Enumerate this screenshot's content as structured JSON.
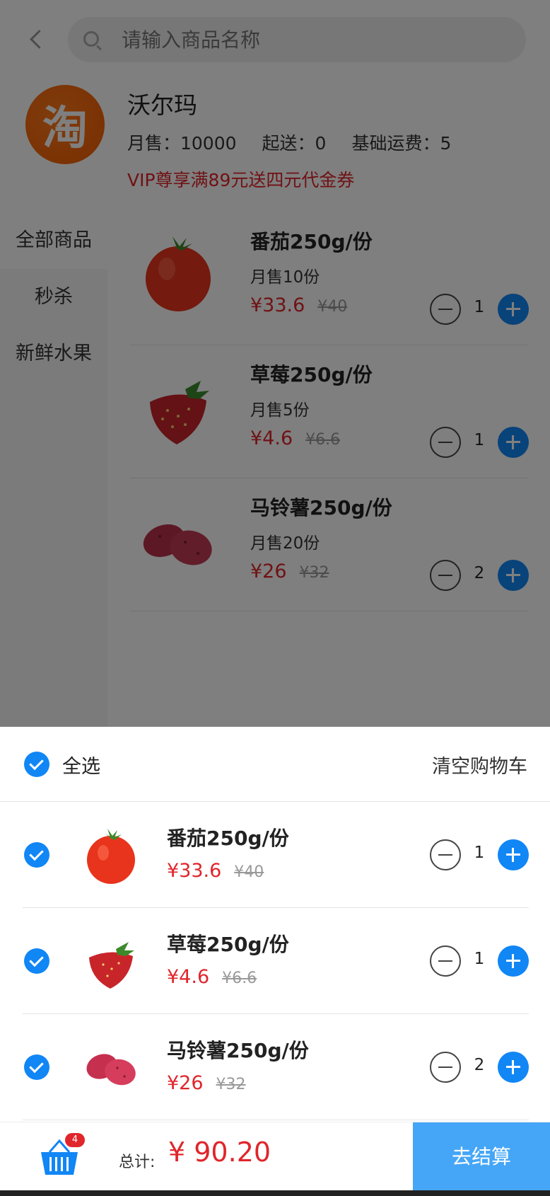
{
  "search": {
    "placeholder": "请输入商品名称"
  },
  "shop": {
    "logo_text": "淘",
    "name": "沃尔玛",
    "monthly_sales": "月售：10000",
    "min_delivery": "起送：0",
    "base_shipping": "基础运费：5",
    "promo": "VIP尊享满89元送四元代金券"
  },
  "categories": [
    "全部商品",
    "秒杀",
    "新鲜水果"
  ],
  "products": [
    {
      "name": "番茄250g/份",
      "sales": "月售10份",
      "price": "¥33.6",
      "old_price": "¥40",
      "qty": "1",
      "image": "tomato"
    },
    {
      "name": "草莓250g/份",
      "sales": "月售5份",
      "price": "¥4.6",
      "old_price": "¥6.6",
      "qty": "1",
      "image": "strawberry"
    },
    {
      "name": "马铃薯250g/份",
      "sales": "月售20份",
      "price": "¥26",
      "old_price": "¥32",
      "qty": "2",
      "image": "potato"
    }
  ],
  "cart": {
    "select_all_label": "全选",
    "clear_label": "清空购物车",
    "items": [
      {
        "name": "番茄250g/份",
        "price": "¥33.6",
        "old_price": "¥40",
        "qty": "1",
        "checked": true
      },
      {
        "name": "草莓250g/份",
        "price": "¥4.6",
        "old_price": "¥6.6",
        "qty": "1",
        "checked": true
      },
      {
        "name": "马铃薯250g/份",
        "price": "¥26",
        "old_price": "¥32",
        "qty": "2",
        "checked": true
      }
    ]
  },
  "bottom": {
    "badge_count": "4",
    "total_label": "总计:",
    "total_value": "¥ 90.20",
    "checkout_label": "去结算"
  },
  "colors": {
    "accent_blue": "#1186f5",
    "price_red": "#e0252b",
    "checkout_blue": "#45a6f7"
  }
}
